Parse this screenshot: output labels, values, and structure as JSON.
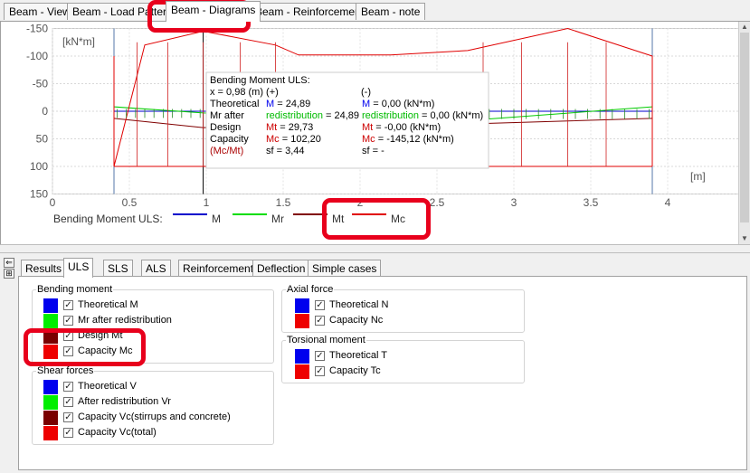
{
  "top_tabs": [
    "Beam - View",
    "Beam - Load Pattern",
    "Beam - Diagrams",
    "Beam - Reinforcement",
    "Beam - note"
  ],
  "top_tabs_active": "Beam - Diagrams",
  "chart_data": {
    "type": "line",
    "ylabel": "[kN*m]",
    "xlabel": "[m]",
    "y_axis_inverted": true,
    "xlim": [
      0,
      4.75
    ],
    "ylim": [
      -150,
      150
    ],
    "x_ticks": [
      "0",
      "0.5",
      "1",
      "1.5",
      "2",
      "2.5",
      "3",
      "3.5",
      "4"
    ],
    "y_ticks": [
      "-150",
      "-100",
      "-50",
      "0",
      "50",
      "100",
      "150"
    ],
    "supports_x": [
      0.4,
      0.98,
      3.9
    ],
    "series": [
      {
        "name": "M",
        "color": "#0000cc",
        "x": [
          0.4,
          0.98,
          2.84,
          3.9
        ],
        "y": [
          0,
          0,
          0,
          0
        ]
      },
      {
        "name": "Mr",
        "color": "#00cc00",
        "x": [
          0.4,
          0.98,
          2.84,
          3.9
        ],
        "y": [
          -8,
          3,
          14,
          -8
        ]
      },
      {
        "name": "Mt",
        "color": "#800000",
        "x": [
          0.4,
          0.98,
          2.84,
          3.9
        ],
        "y": [
          13,
          29.73,
          22,
          13
        ]
      },
      {
        "name": "Mc",
        "color": "#e00000",
        "x": [
          0.4,
          0.4,
          0.6,
          0.98,
          1.45,
          1.6,
          2.2,
          2.7,
          3.35,
          3.9,
          3.9
        ],
        "y": [
          -100,
          100,
          -120,
          -145.12,
          -120,
          -102,
          -102,
          -110,
          -150,
          -100,
          100
        ]
      },
      {
        "name": "Mc bottom",
        "color": "#e00000",
        "x": [
          0.4,
          0.75,
          0.98,
          2.84,
          3.35,
          3.9
        ],
        "y": [
          100,
          100,
          100,
          100,
          100,
          100
        ]
      }
    ]
  },
  "tooltip": {
    "title": "Bending Moment ULS:",
    "x_line": "x = 0,98 (m)  (+)",
    "minus": "(-)",
    "rows": [
      {
        "label": "Theoretical",
        "plus_key": "M",
        "plus_val": " = 24,89",
        "minus_key": "M",
        "minus_val": " = 0,00 (kN*m)"
      },
      {
        "label": "Mr after",
        "plus_key": "redistribution",
        "plus_val": " = 24,89",
        "minus_key": "redistribution",
        "minus_val": " = 0,00 (kN*m)"
      },
      {
        "label": "Design",
        "plus_key": "Mt",
        "plus_val": " = 29,73",
        "minus_key": "Mt",
        "minus_val": " = -0,00 (kN*m)"
      },
      {
        "label": "Capacity",
        "plus_key": "Mc",
        "plus_val": " = 102,20",
        "minus_key": "Mc",
        "minus_val": " = -145,12 (kN*m)"
      },
      {
        "label": "(Mc/Mt)",
        "plus_key": "sf",
        "plus_val": " = 3,44",
        "minus_key": "sf",
        "minus_val": " = -"
      }
    ]
  },
  "legend": {
    "title": "Bending Moment ULS:",
    "items": [
      {
        "label": "M",
        "color": "#0000cc"
      },
      {
        "label": "Mr",
        "color": "#00dd00"
      },
      {
        "label": "Mt",
        "color": "#800000"
      },
      {
        "label": "Mc",
        "color": "#e00000"
      }
    ]
  },
  "side_buttons": [
    "⇐",
    "⊞"
  ],
  "bottom_tabs": [
    "Results",
    "ULS",
    "SLS",
    "ALS",
    "Reinforcement",
    "Deflection",
    "Simple cases"
  ],
  "bottom_tabs_active": "ULS",
  "groups": {
    "bending": {
      "title": "Bending moment",
      "items": [
        {
          "label": "Theoretical M",
          "color": "#0000ee",
          "checked": true
        },
        {
          "label": "Mr after redistribution",
          "color": "#00ee00",
          "checked": true
        },
        {
          "label": "Design Mt",
          "color": "#7a0000",
          "checked": true
        },
        {
          "label": "Capacity Mc",
          "color": "#ee0000",
          "checked": true
        }
      ]
    },
    "shear": {
      "title": "Shear forces",
      "items": [
        {
          "label": "Theoretical V",
          "color": "#0000ee",
          "checked": true
        },
        {
          "label": "After redistribution Vr",
          "color": "#00ee00",
          "checked": true
        },
        {
          "label": "Capacity Vc(stirrups and concrete)",
          "color": "#7a0000",
          "checked": true
        },
        {
          "label": "Capacity Vc(total)",
          "color": "#ee0000",
          "checked": true
        }
      ]
    },
    "axial": {
      "title": "Axial force",
      "items": [
        {
          "label": "Theoretical N",
          "color": "#0000ee",
          "checked": true
        },
        {
          "label": "Capacity Nc",
          "color": "#ee0000",
          "checked": true
        }
      ]
    },
    "torsion": {
      "title": "Torsional moment",
      "items": [
        {
          "label": "Theoretical T",
          "color": "#0000ee",
          "checked": true
        },
        {
          "label": "Capacity Tc",
          "color": "#ee0000",
          "checked": true
        }
      ]
    }
  },
  "checkmark": "✓"
}
